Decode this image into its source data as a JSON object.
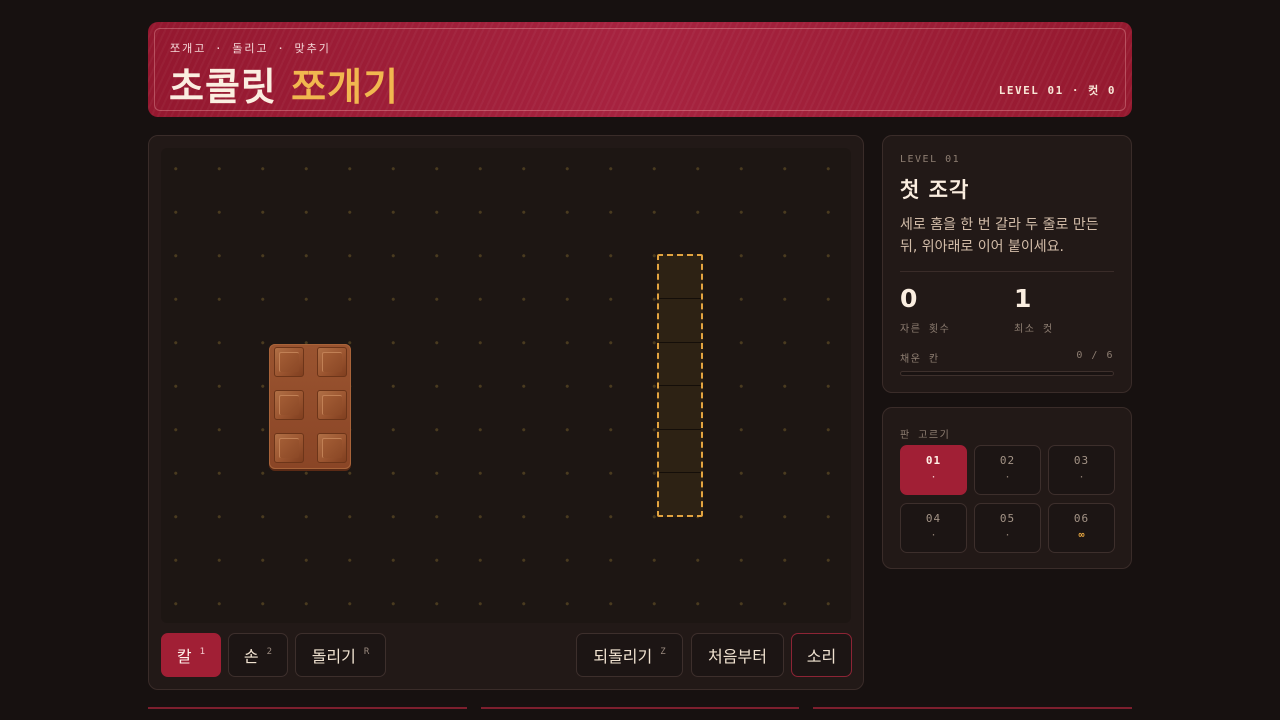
{
  "header": {
    "subtitle": "쪼개고 · 돌리고 · 맞추기",
    "title_part1": "초콜릿",
    "title_part2": "쪼개기",
    "level_status": "LEVEL 01 · 컷 0"
  },
  "board": {
    "chocolate": {
      "rows": 3,
      "cols": 2
    },
    "target": {
      "rows": 6,
      "cols": 1
    }
  },
  "toolbar": {
    "knife": {
      "label": "칼",
      "key": "1"
    },
    "hand": {
      "label": "손",
      "key": "2"
    },
    "rotate": {
      "label": "돌리기",
      "key": "R"
    },
    "undo": {
      "label": "되돌리기",
      "key": "Z"
    },
    "reset": {
      "label": "처음부터"
    },
    "sound": {
      "label": "소리"
    }
  },
  "info": {
    "level_label": "LEVEL 01",
    "title": "첫 조각",
    "description": "세로 홈을 한 번 갈라 두 줄로 만든 뒤, 위아래로 이어 붙이세요.",
    "cuts": {
      "value": "0",
      "label": "자른 횟수"
    },
    "min_cuts": {
      "value": "1",
      "label": "최소 컷"
    },
    "filled": {
      "label": "채운 칸",
      "value": "0 / 6",
      "fraction": 0
    }
  },
  "level_picker": {
    "title": "판 고르기",
    "levels": [
      {
        "num": "01",
        "mark": "·"
      },
      {
        "num": "02",
        "mark": "·"
      },
      {
        "num": "03",
        "mark": "·"
      },
      {
        "num": "04",
        "mark": "·"
      },
      {
        "num": "05",
        "mark": "·"
      },
      {
        "num": "06",
        "mark": "∞"
      }
    ]
  },
  "colors": {
    "accent_red": "#a11f35",
    "accent_gold": "#e3a440",
    "chocolate": "#9b5530",
    "background": "#171110"
  }
}
